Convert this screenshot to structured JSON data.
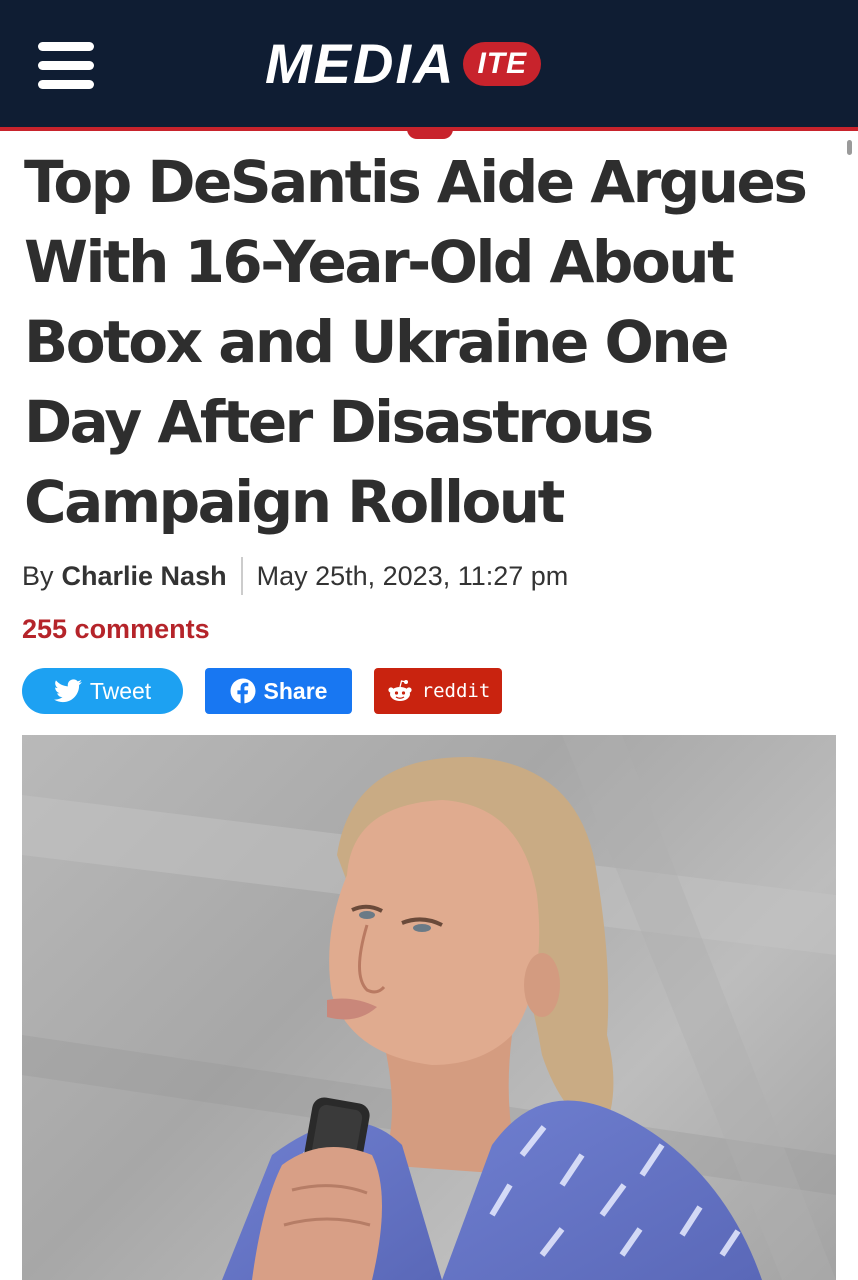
{
  "header": {
    "menu_icon": "hamburger-icon",
    "logo_main": "MEDIA",
    "logo_badge": "ITE"
  },
  "article": {
    "title": "Top DeSantis Aide Argues With 16-Year-Old About Botox and Ukraine One Day After Disastrous Campaign Rollout",
    "byline_prefix": "By",
    "author": "Charlie Nash",
    "date": "May 25th, 2023, 11:27 pm",
    "comments": "255 comments"
  },
  "share": {
    "tweet_label": "Tweet",
    "facebook_label": "Share",
    "reddit_label": "reddit"
  },
  "colors": {
    "header_bg": "#0f1d33",
    "brand_red": "#c8232c",
    "twitter_blue": "#1da1f2",
    "facebook_blue": "#1877f2",
    "reddit_red": "#c9230f",
    "comments_red": "#b5242a"
  }
}
